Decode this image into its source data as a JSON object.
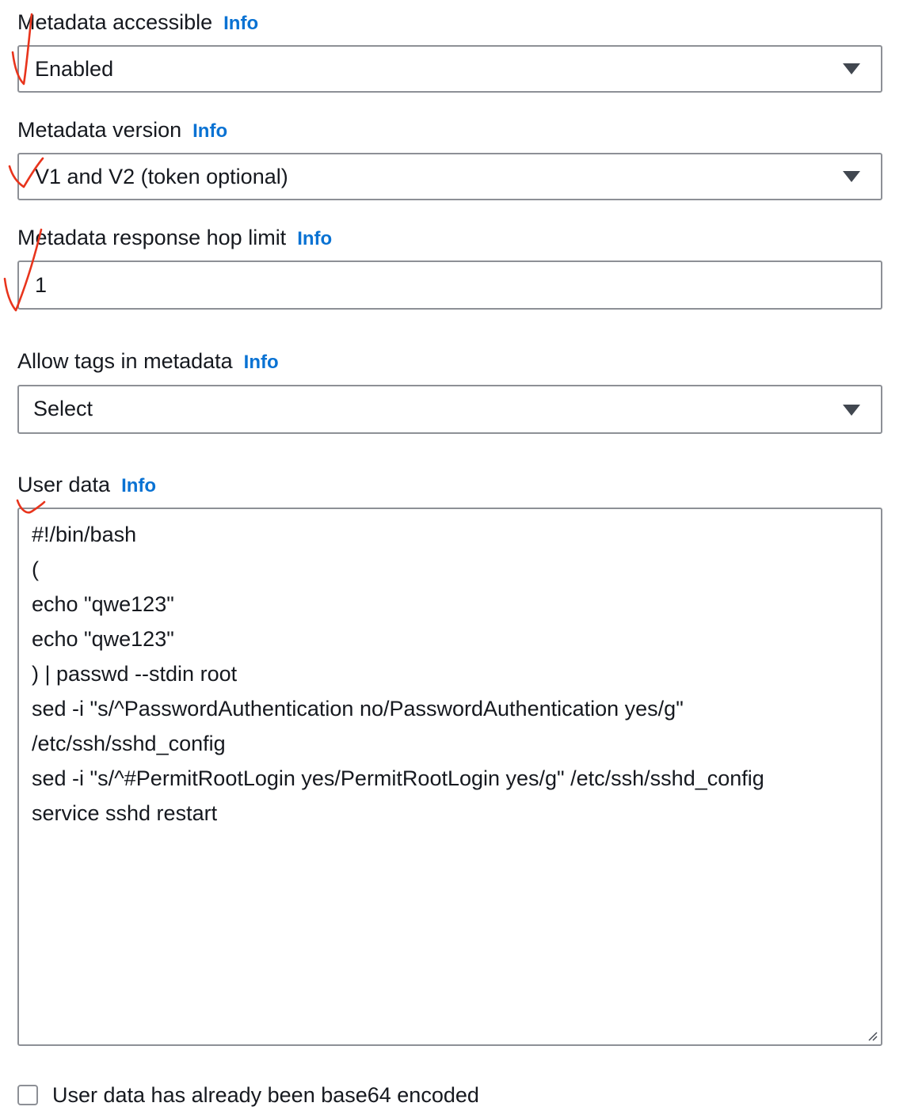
{
  "fields": {
    "metadata_accessible": {
      "label": "Metadata accessible",
      "info": "Info",
      "value": "Enabled"
    },
    "metadata_version": {
      "label": "Metadata version",
      "info": "Info",
      "value": "V1 and V2 (token optional)"
    },
    "hop_limit": {
      "label": "Metadata response hop limit",
      "info": "Info",
      "value": "1"
    },
    "allow_tags": {
      "label": "Allow tags in metadata",
      "info": "Info",
      "value": "Select"
    },
    "user_data": {
      "label": "User data",
      "info": "Info",
      "lines": [
        "#!/bin/bash",
        "(",
        "echo \"qwe123\"",
        "echo \"qwe123\"",
        ") | passwd --stdin root",
        "sed -i \"s/^PasswordAuthentication no/PasswordAuthentication yes/g\"",
        "/etc/ssh/sshd_config",
        "sed -i \"s/^#PermitRootLogin yes/PermitRootLogin yes/g\" /etc/ssh/sshd_config",
        "service sshd restart"
      ]
    }
  },
  "base64_checkbox": {
    "label": "User data has already been base64 encoded",
    "checked": false
  },
  "colors": {
    "info_link": "#0972d3",
    "border": "#8d9096",
    "text": "#16191f",
    "annotation_marks": "#e8341c"
  }
}
